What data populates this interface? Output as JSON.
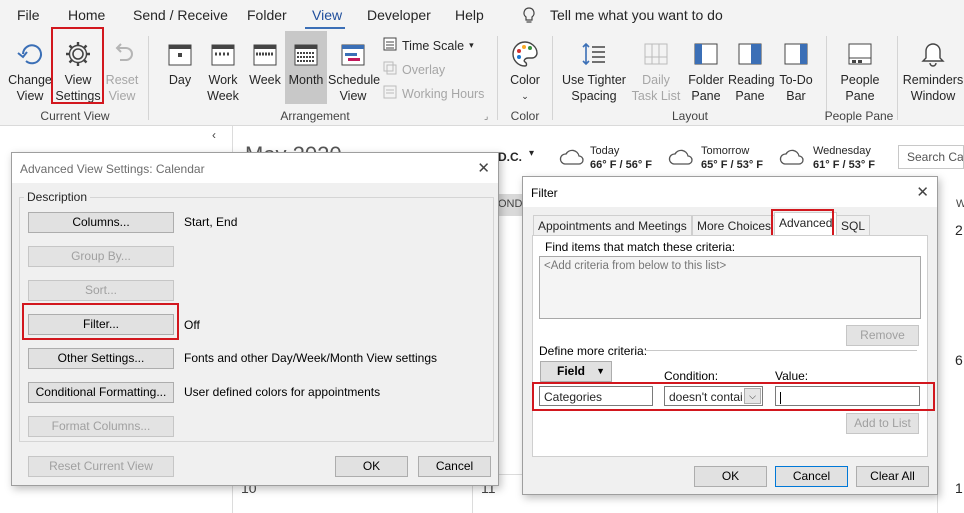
{
  "menu": [
    "File",
    "Home",
    "Send / Receive",
    "Folder",
    "View",
    "Developer",
    "Help"
  ],
  "tell_me": "Tell me what you want to do",
  "ribbon": {
    "change_view": "Change View",
    "view_settings": "View Settings",
    "reset_view": "Reset View",
    "current_view_group": "Current View",
    "day": "Day",
    "work_week": "Work Week",
    "week": "Week",
    "month": "Month",
    "schedule_view": "Schedule View",
    "time_scale": "Time Scale",
    "overlay": "Overlay",
    "working_hours": "Working Hours",
    "arrangement_group": "Arrangement",
    "color": "Color",
    "color_group": "Color",
    "use_tighter_spacing": "Use Tighter Spacing",
    "daily_task_list": "Daily Task List",
    "folder_pane": "Folder Pane",
    "reading_pane": "Reading Pane",
    "todo_bar": "To-Do Bar",
    "layout_group": "Layout",
    "people_pane": "People Pane",
    "people_pane_group": "People Pane",
    "reminders_window": "Reminders Window"
  },
  "calendar": {
    "title_partial": "May 2020",
    "location": "D.C.",
    "weather": [
      {
        "day": "Today",
        "temps": "66° F / 56° F"
      },
      {
        "day": "Tomorrow",
        "temps": "65° F / 53° F"
      },
      {
        "day": "Wednesday",
        "temps": "61° F / 53° F"
      }
    ],
    "search_placeholder": "Search Cale",
    "day_header": "ONDA",
    "right_header": "W",
    "numbers": [
      "2",
      "6",
      "1",
      "10",
      "11"
    ]
  },
  "advanced_view_settings": {
    "title": "Advanced View Settings: Calendar",
    "description_label": "Description",
    "rows": [
      {
        "button": "Columns...",
        "value": "Start, End",
        "enabled": true
      },
      {
        "button": "Group By...",
        "value": "",
        "enabled": false
      },
      {
        "button": "Sort...",
        "value": "",
        "enabled": false
      },
      {
        "button": "Filter...",
        "value": "Off",
        "enabled": true
      },
      {
        "button": "Other Settings...",
        "value": "Fonts and other Day/Week/Month View settings",
        "enabled": true
      },
      {
        "button": "Conditional Formatting...",
        "value": "User defined colors for appointments",
        "enabled": true
      },
      {
        "button": "Format Columns...",
        "value": "",
        "enabled": false
      }
    ],
    "reset_current_view": "Reset Current View",
    "ok": "OK",
    "cancel": "Cancel"
  },
  "filter": {
    "title": "Filter",
    "tabs": [
      "Appointments and Meetings",
      "More Choices",
      "Advanced",
      "SQL"
    ],
    "find_label": "Find items that match these criteria:",
    "criteria_placeholder": "<Add criteria from below to this list>",
    "remove": "Remove",
    "define_label": "Define more criteria:",
    "field_button": "Field",
    "condition_label": "Condition:",
    "value_label": "Value:",
    "field_value": "Categories",
    "condition_value": "doesn't contai",
    "value_value": "",
    "add_to_list": "Add to List",
    "ok": "OK",
    "cancel": "Cancel",
    "clear_all": "Clear All"
  },
  "colors": {
    "accent": "#3b6fb6",
    "highlight": "#d2171e"
  }
}
